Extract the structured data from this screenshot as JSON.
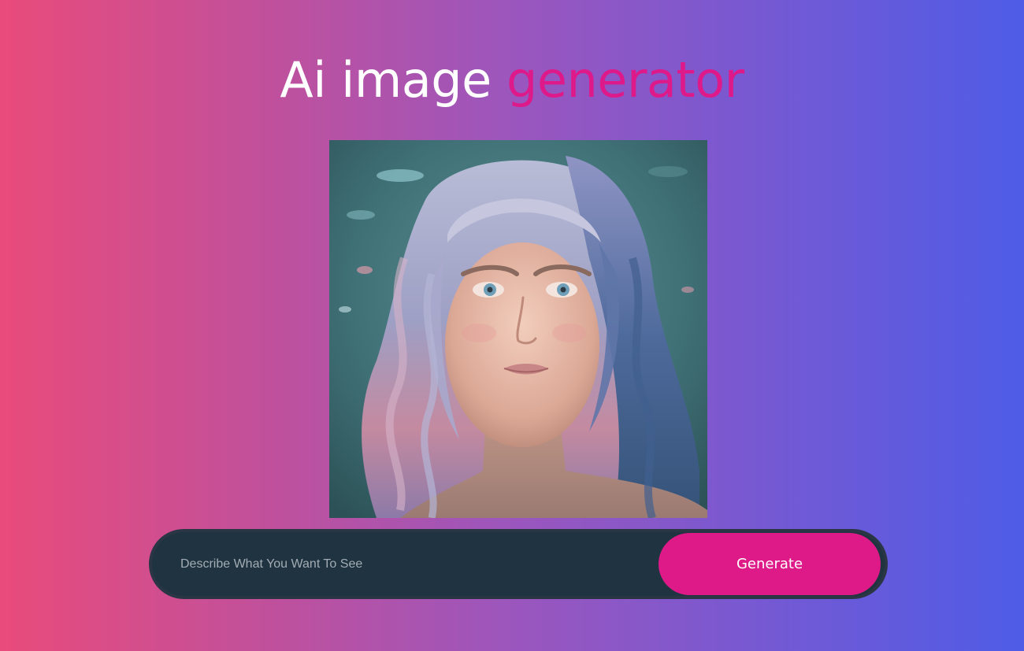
{
  "header": {
    "title_main": "Ai image ",
    "title_accent": "generator"
  },
  "image": {
    "alt": "Generated portrait of a young woman with long wavy lavender-blue hair in water"
  },
  "prompt": {
    "placeholder": "Describe What You Want To See",
    "value": ""
  },
  "generate_button": {
    "label": "Generate"
  },
  "colors": {
    "gradient_left": "#e94b7b",
    "gradient_right": "#4e5ce6",
    "accent": "#de1a88",
    "bar_background": "#1f3440"
  }
}
